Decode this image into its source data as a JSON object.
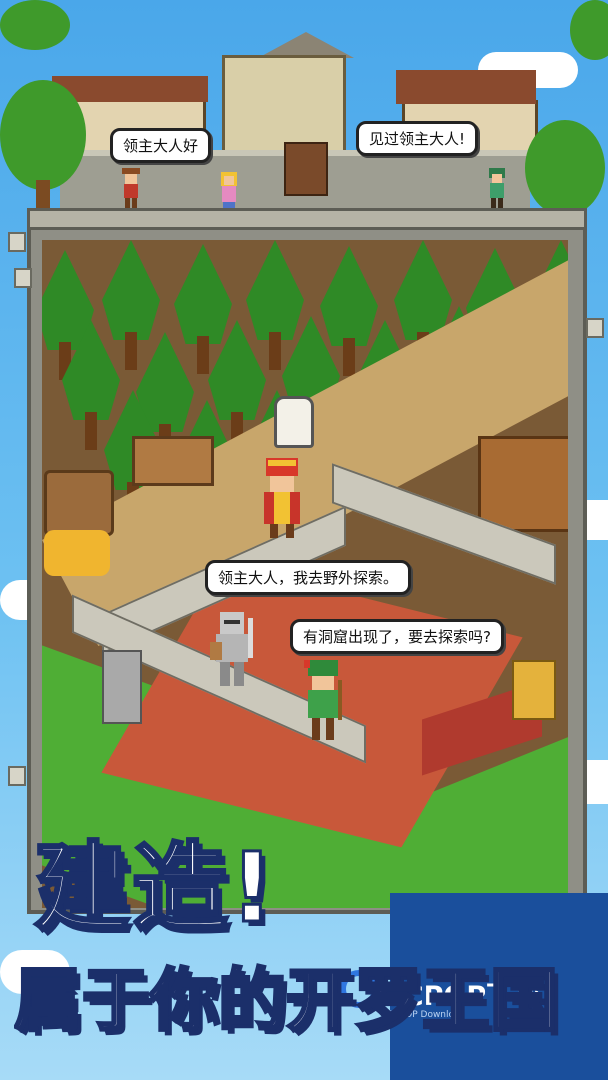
{
  "speech": {
    "top_left": "领主大人好",
    "top_right": "见过领主大人!",
    "knight": "领主大人，我去野外探索。",
    "archer": "有洞窟出现了，要去探索吗?"
  },
  "headline": {
    "line1": "建造!",
    "line2": "属于你的开罗王国"
  },
  "watermark": {
    "brand": "PCPOP下载",
    "sub": "PCPOP Download"
  },
  "colors": {
    "headline_fill": "#ffffff",
    "headline_stroke": "#1b2f6a",
    "watermark_bg": "#1a4f9c"
  }
}
